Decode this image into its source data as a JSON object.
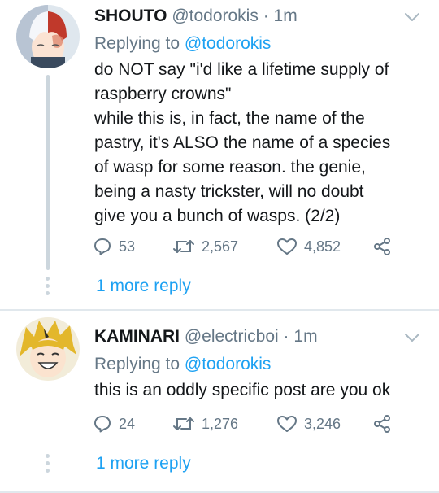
{
  "tweets": [
    {
      "display_name": "SHOUTO",
      "handle": "@todorokis",
      "separator": "·",
      "time": "1m",
      "replying_prefix": "Replying to",
      "replying_to": "@todorokis",
      "body_lines": [
        "do NOT say \"i'd like a lifetime supply of",
        "raspberry crowns\"",
        "while this is, in fact, the name of the",
        "pastry, it's ALSO the name of a species",
        "of wasp for some reason. the genie,",
        "being a nasty trickster, will no doubt",
        "give you a bunch of wasps. (2/2)"
      ],
      "reply_count": "53",
      "retweet_count": "2,567",
      "like_count": "4,852",
      "more_reply": "1 more reply"
    },
    {
      "display_name": "KAMINARI",
      "handle": "@electricboi",
      "separator": "·",
      "time": "1m",
      "replying_prefix": "Replying to",
      "replying_to": "@todorokis",
      "body_lines": [
        "this is an oddly specific post are you ok"
      ],
      "reply_count": "24",
      "retweet_count": "1,276",
      "like_count": "3,246",
      "more_reply": "1 more reply"
    }
  ],
  "icons": {
    "reply": "speech-bubble",
    "retweet": "retweet-arrows",
    "like": "heart",
    "share": "share-nodes",
    "menu": "chevron-down"
  },
  "colors": {
    "link": "#1da1f2",
    "muted": "#657786",
    "text": "#14171a",
    "divider": "#e1e8ed",
    "thread_line": "#ccd6dd"
  }
}
